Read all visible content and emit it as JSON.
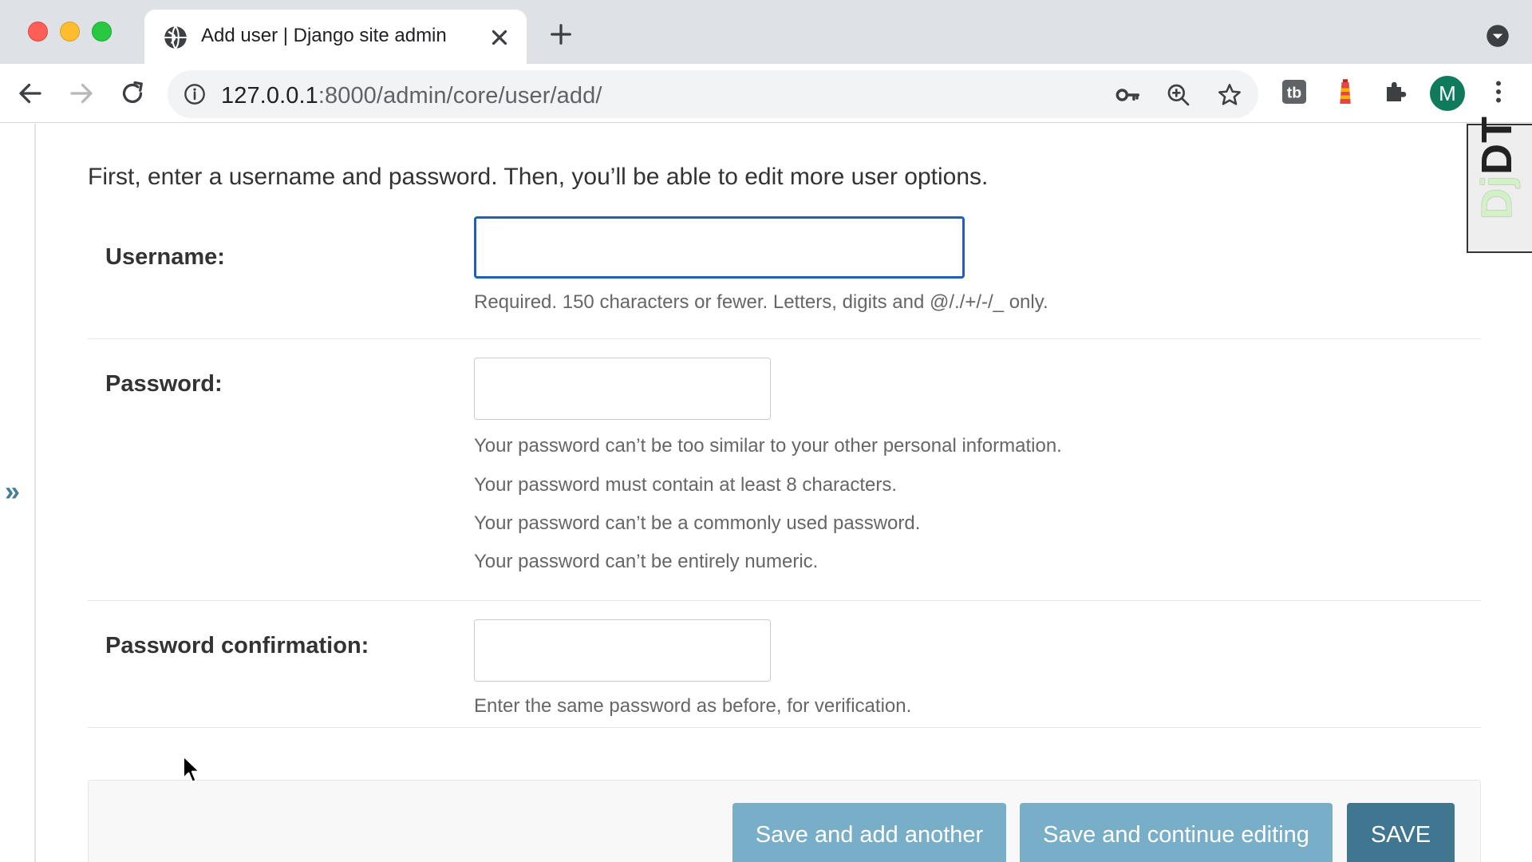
{
  "browser": {
    "tab_title": "Add user | Django site admin",
    "url_host": "127.0.0.1",
    "url_rest": ":8000/admin/core/user/add/",
    "profile_initial": "M"
  },
  "page": {
    "intro": "First, enter a username and password. Then, you’ll be able to edit more user options.",
    "fields": {
      "username": {
        "label": "Username:",
        "value": "",
        "help": "Required. 150 characters or fewer. Letters, digits and @/./+/-/_ only."
      },
      "password": {
        "label": "Password:",
        "value": "",
        "help": [
          "Your password can’t be too similar to your other personal information.",
          "Your password must contain at least 8 characters.",
          "Your password can’t be a commonly used password.",
          "Your password can’t be entirely numeric."
        ]
      },
      "password_confirmation": {
        "label": "Password confirmation:",
        "value": "",
        "help": "Enter the same password as before, for verification."
      }
    },
    "buttons": {
      "save_add_another": "Save and add another",
      "save_continue": "Save and continue editing",
      "save": "SAVE"
    },
    "sidebar_toggle": "»",
    "debug_toolbar": {
      "dj": "Dj",
      "dt": "DT"
    }
  },
  "colors": {
    "focus_border": "#2260b5",
    "button_light": "#79aec8",
    "button_dark": "#417690",
    "link": "#447e9b"
  }
}
